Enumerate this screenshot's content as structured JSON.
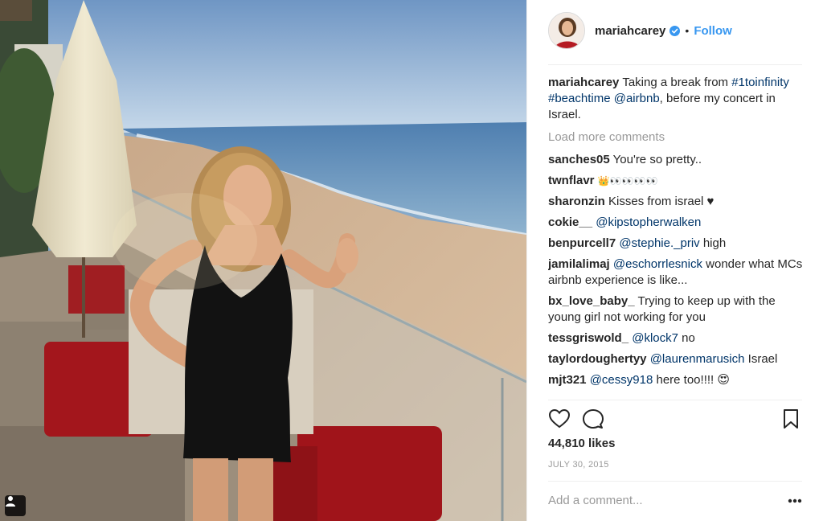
{
  "header": {
    "username": "mariahcarey",
    "separator": "•",
    "follow_label": "Follow"
  },
  "caption": {
    "username": "mariahcarey",
    "text_1": "Taking a break from ",
    "hashtag_1": "#1toinfinity",
    "hashtag_2": "#beachtime",
    "mention": "@airbnb",
    "text_2": ", before my concert in Israel."
  },
  "load_more_label": "Load more comments",
  "comments": [
    {
      "username": "sanches05",
      "text": "You're so pretty.."
    },
    {
      "username": "twnflavr",
      "text": "👑👀👀👀👀"
    },
    {
      "username": "sharonzin",
      "text": "Kisses from israel ♥"
    },
    {
      "username": "cokie__",
      "mention": "@kipstopherwalken",
      "text": ""
    },
    {
      "username": "benpurcell7",
      "mention": "@stephie._priv",
      "text": "high"
    },
    {
      "username": "jamilalimaj",
      "mention": "@eschorrlesnick",
      "text": "wonder what MCs airbnb experience is like..."
    },
    {
      "username": "bx_love_baby_",
      "text": "Trying to keep up with the young girl not working for you"
    },
    {
      "username": "tessgriswold_",
      "mention": "@klock7",
      "text": "no"
    },
    {
      "username": "taylordoughertyy",
      "mention": "@laurenmarusich",
      "text": "Israel"
    },
    {
      "username": "mjt321",
      "mention": "@cessy918",
      "text": "here too!!!! 😍"
    }
  ],
  "likes_label": "44,810 likes",
  "date_label": "JULY 30, 2015",
  "add_comment_placeholder": "Add a comment...",
  "icons": {
    "like": "heart-icon",
    "comment": "comment-icon",
    "save": "bookmark-icon",
    "more": "more-options-icon",
    "verified": "verified-badge-icon",
    "tag": "user-tag-icon"
  },
  "colors": {
    "link_blue": "#3897f0",
    "mention_dark_blue": "#003569",
    "muted_gray": "#999999",
    "text": "#262626"
  }
}
